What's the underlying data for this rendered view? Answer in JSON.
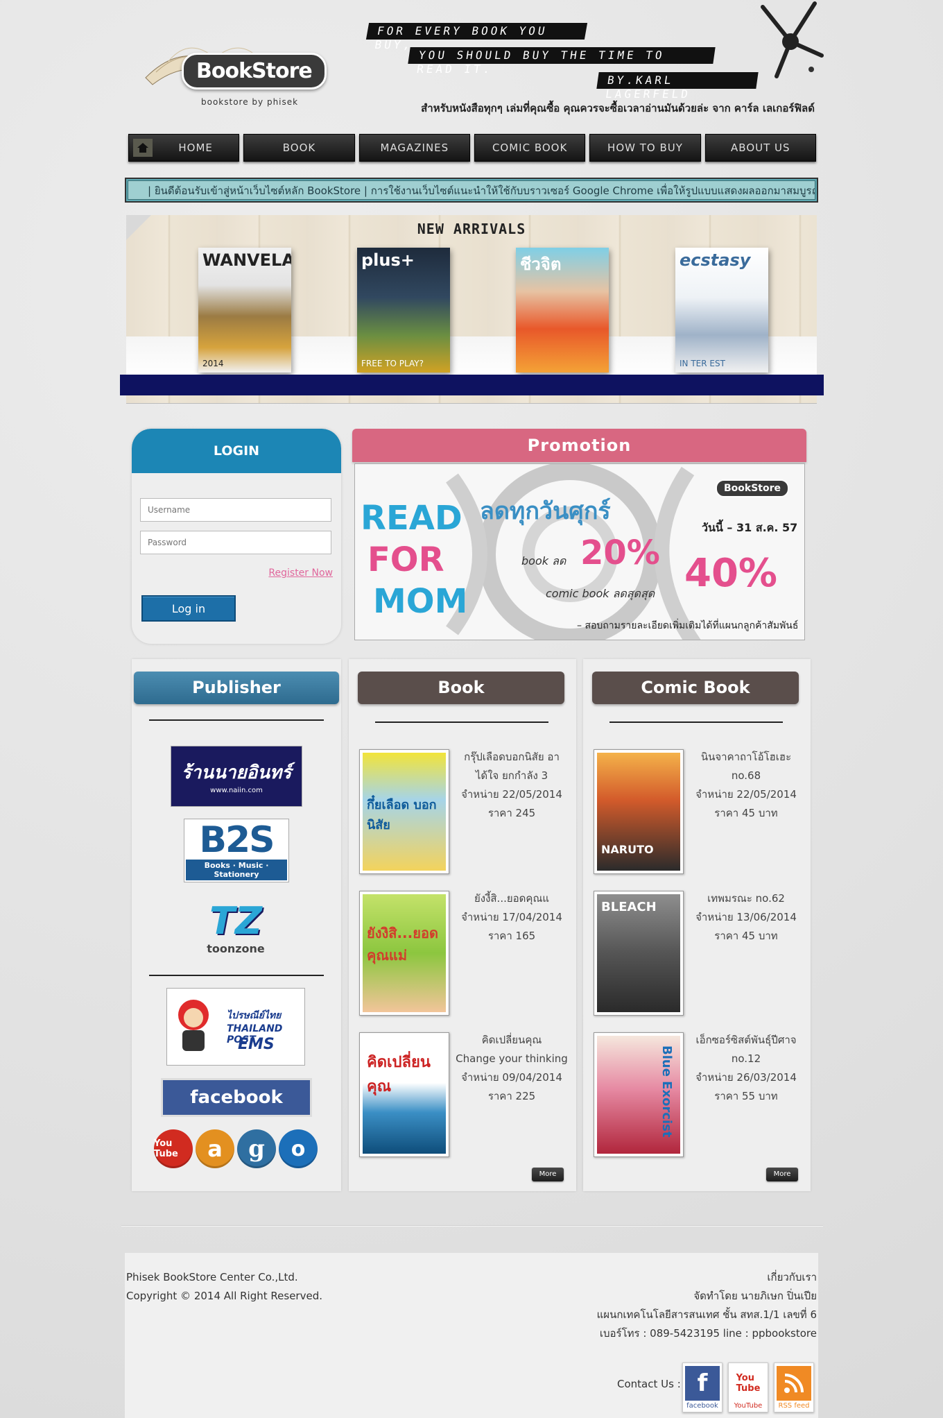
{
  "header": {
    "logo_text": "BookStore",
    "logo_tagline": "bookstore by phisek",
    "quote_lines": [
      "FOR EVERY BOOK YOU BUY,",
      "YOU SHOULD BUY THE TIME TO READ IT.",
      "BY.KARL LAGERFELD"
    ],
    "quote_thai": "สำหรับหนังสือทุกๆ เล่มที่คุณซื้อ คุณควรจะซื้อเวลาอ่านมันด้วยล่ะ  จาก คาร์ล เลเกอร์ฟิลด์"
  },
  "nav": {
    "home": "HOME",
    "book": "BOOK",
    "magazines": "MAGAZINES",
    "comic_book": "COMIC BOOK",
    "how_to_buy": "HOW TO BUY",
    "about_us": "ABOUT US"
  },
  "welcome": "| ยินดีต้อนรับเข้าสู่หน้าเว็บไซต์หลัก BookStore | การใช้งานเว็บไซต์แนะนำให้ใช้กับบราวเซอร์ Google Chrome เพื่อให้รูปแบบแสดงผลออกมาสมบูรณ์",
  "arrivals": {
    "title": "NEW ARRIVALS",
    "magazines": [
      {
        "title": "WANVELA",
        "sub": "2014"
      },
      {
        "title": "plus+",
        "sub": "FREE TO PLAY?"
      },
      {
        "title": "ชีวจิต",
        "sub": ""
      },
      {
        "title": "ecstasy",
        "sub": "IN TER EST"
      }
    ]
  },
  "login": {
    "title": "LOGIN",
    "username_placeholder": "Username",
    "password_placeholder": "Password",
    "register": "Register Now",
    "button": "Log in"
  },
  "promotion": {
    "title": "Promotion",
    "words": [
      "READ",
      "FOR",
      "MOM"
    ],
    "headline": "ลดทุกวันศุกร์",
    "book_label": "book ลด",
    "book_discount": "20%",
    "comic_label": "comic book ลดสุดสุด",
    "comic_discount": "40%",
    "date": "วันนี้ – 31 ส.ค. 57",
    "logo": "BookStore",
    "note": "– สอบถามรายละเอียดเพิ่มเติมได้ที่แผนกลูกค้าสัมพันธ์"
  },
  "publisher": {
    "title": "Publisher",
    "naiin": "ร้านนายอินทร์",
    "naiin_url": "www.naiin.com",
    "b2s": "B2S",
    "b2s_bar": "Books · Music · Stationery",
    "toonzone": "TZ",
    "toonzone_word": "toonzone",
    "thaipost": "ไปรษณีย์ไทย THAILAND POST",
    "ems": "EMS",
    "facebook": "facebook",
    "social": [
      "You Tube",
      "a",
      "g",
      "o"
    ]
  },
  "book": {
    "title": "Book",
    "more": "More",
    "items": [
      {
        "cover": "กึ๋ยเลือด บอกนิสัย",
        "lines": [
          "กรุ๊ปเลือดบอกนิสัย อา",
          "ได้ใจ ยกกำลัง 3",
          "จำหน่าย 22/05/2014",
          "ราคา 245"
        ]
      },
      {
        "cover": "ยังงิสิ...ยอดคุณแม่",
        "lines": [
          "ยังงี้สิ...ยอดคุณแ",
          "จำหน่าย 17/04/2014",
          "ราคา 165"
        ]
      },
      {
        "cover": "คิดเปลี่ยนคุณ",
        "lines": [
          "คิดเปลี่ยนคุณ",
          "Change your thinking",
          "จำหน่าย 09/04/2014",
          "ราคา 225"
        ]
      }
    ]
  },
  "comic": {
    "title": "Comic Book",
    "more": "More",
    "items": [
      {
        "cover": "NARUTO",
        "lines": [
          "นินจาคาถาโอ้โฮเฮะ",
          "no.68",
          "จำหน่าย 22/05/2014",
          "ราคา 45 บาท"
        ]
      },
      {
        "cover": "BLEACH",
        "lines": [
          "เทพมรณะ no.62",
          "จำหน่าย 13/06/2014",
          "ราคา 45 บาท"
        ]
      },
      {
        "cover": "Blue Exorcist",
        "lines": [
          "เอ็กซอร์ซิสต์พันธุ์ปีศาจ",
          "no.12",
          "จำหน่าย 26/03/2014",
          "ราคา 55 บาท"
        ]
      }
    ]
  },
  "footer": {
    "left": [
      "Phisek BookStore Center Co.,Ltd.",
      "Copyright © 2014 All Right Reserved."
    ],
    "right": [
      "เกี่ยวกับเรา",
      "จัดทำโดย นายภิเษก ปิ่นเปีย",
      "แผนกเทคโนโลยีสารสนเทศ ชั้น สทส.1/1 เลขที่ 6",
      "เบอร์โทร : 089-5423195 line : ppbookstore"
    ],
    "contact": "Contact Us :",
    "icons": [
      "facebook",
      "YouTube",
      "RSS feed"
    ]
  }
}
